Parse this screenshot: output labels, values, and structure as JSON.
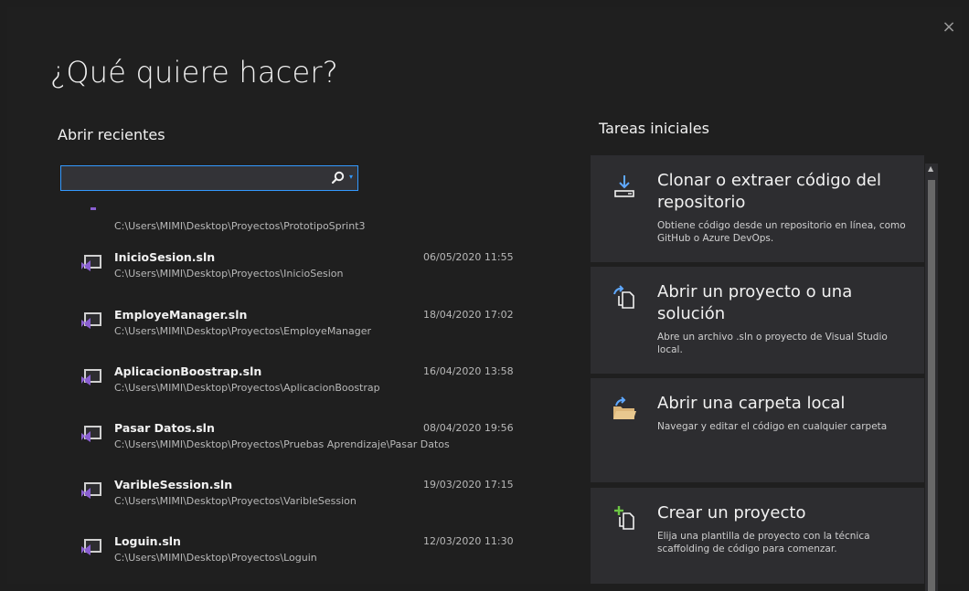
{
  "dialog": {
    "title": "¿Qué quiere hacer?",
    "close_glyph": "×"
  },
  "recent": {
    "heading": "Abrir recientes",
    "search": {
      "value": "",
      "placeholder": "",
      "icon": "search-icon"
    },
    "partial_item_path": "C:\\Users\\MIMI\\Desktop\\Proyectos\\PrototipoSprint3",
    "items": [
      {
        "name": "InicioSesion.sln",
        "path": "C:\\Users\\MIMI\\Desktop\\Proyectos\\InicioSesion",
        "date": "06/05/2020 11:55"
      },
      {
        "name": "EmployeManager.sln",
        "path": "C:\\Users\\MIMI\\Desktop\\Proyectos\\EmployeManager",
        "date": "18/04/2020 17:02"
      },
      {
        "name": "AplicacionBoostrap.sln",
        "path": "C:\\Users\\MIMI\\Desktop\\Proyectos\\AplicacionBoostrap",
        "date": "16/04/2020 13:58"
      },
      {
        "name": "Pasar Datos.sln",
        "path": "C:\\Users\\MIMI\\Desktop\\Proyectos\\Pruebas Aprendizaje\\Pasar Datos",
        "date": "08/04/2020 19:56"
      },
      {
        "name": "VaribleSession.sln",
        "path": "C:\\Users\\MIMI\\Desktop\\Proyectos\\VaribleSession",
        "date": "19/03/2020 17:15"
      },
      {
        "name": "Loguin.sln",
        "path": "C:\\Users\\MIMI\\Desktop\\Proyectos\\Loguin",
        "date": "12/03/2020 11:30"
      }
    ]
  },
  "tasks": {
    "heading": "Tareas iniciales",
    "items": [
      {
        "title": "Clonar o extraer código del repositorio",
        "desc": "Obtiene código desde un repositorio en línea, como GitHub o Azure DevOps.",
        "icon": "clone-download-icon"
      },
      {
        "title": "Abrir un proyecto o una solución",
        "desc": "Abre un archivo .sln o proyecto de Visual Studio local.",
        "icon": "open-project-icon"
      },
      {
        "title": "Abrir una carpeta local",
        "desc": "Navegar y editar el código en cualquier carpeta",
        "icon": "open-folder-icon"
      },
      {
        "title": "Crear un proyecto",
        "desc": "Elija una plantilla de proyecto con la técnica scaffolding de código para comenzar.",
        "icon": "new-project-icon"
      }
    ]
  },
  "colors": {
    "background": "#1f1f1f",
    "tile": "#2d2d30",
    "accent": "#3399ff",
    "vs_purple": "#8a5fd1"
  }
}
